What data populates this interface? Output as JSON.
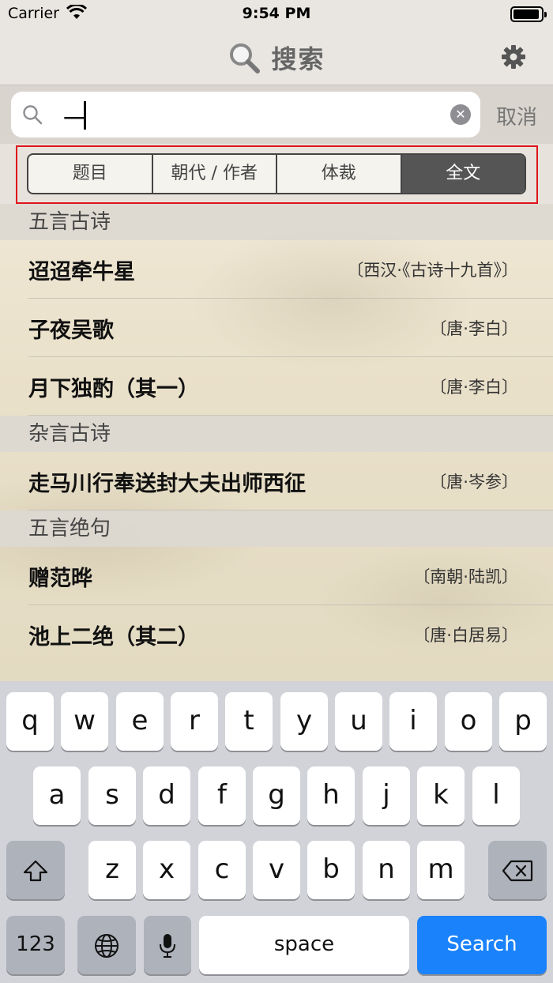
{
  "status_bar": {
    "carrier": "Carrier",
    "time": "9:54 PM"
  },
  "nav": {
    "title": "搜索"
  },
  "search": {
    "query": "一",
    "cancel_label": "取消"
  },
  "segments": [
    {
      "label": "题目",
      "active": false
    },
    {
      "label": "朝代 / 作者",
      "active": false
    },
    {
      "label": "体裁",
      "active": false
    },
    {
      "label": "全文",
      "active": true
    }
  ],
  "sections": [
    {
      "title": "五言古诗",
      "rows": [
        {
          "title": "迢迢牵牛星",
          "author": "〔西汉·《古诗十九首》〕"
        },
        {
          "title": "子夜吴歌",
          "author": "〔唐·李白〕"
        },
        {
          "title": "月下独酌（其一）",
          "author": "〔唐·李白〕"
        }
      ]
    },
    {
      "title": "杂言古诗",
      "rows": [
        {
          "title": "走马川行奉送封大夫出师西征",
          "author": "〔唐·岑参〕"
        }
      ]
    },
    {
      "title": "五言绝句",
      "rows": [
        {
          "title": "赠范晔",
          "author": "〔南朝·陆凯〕"
        },
        {
          "title": "池上二绝（其二）",
          "author": "〔唐·白居易〕"
        }
      ]
    }
  ],
  "keyboard": {
    "row1": [
      "q",
      "w",
      "e",
      "r",
      "t",
      "y",
      "u",
      "i",
      "o",
      "p"
    ],
    "row2": [
      "a",
      "s",
      "d",
      "f",
      "g",
      "h",
      "j",
      "k",
      "l"
    ],
    "row3": [
      "z",
      "x",
      "c",
      "v",
      "b",
      "n",
      "m"
    ],
    "numbers_label": "123",
    "space_label": "space",
    "search_label": "Search"
  }
}
